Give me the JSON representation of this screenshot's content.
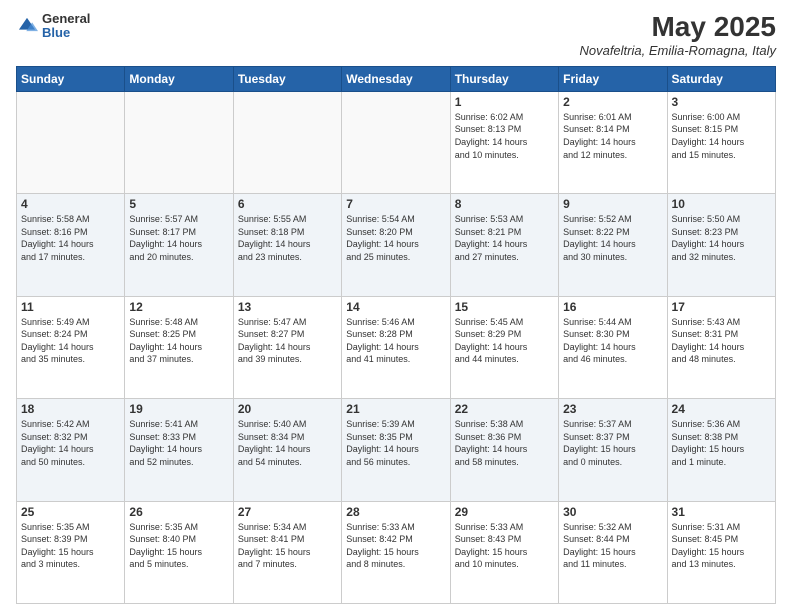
{
  "header": {
    "logo_general": "General",
    "logo_blue": "Blue",
    "title": "May 2025",
    "location": "Novafeltria, Emilia-Romagna, Italy"
  },
  "days_of_week": [
    "Sunday",
    "Monday",
    "Tuesday",
    "Wednesday",
    "Thursday",
    "Friday",
    "Saturday"
  ],
  "weeks": [
    [
      {
        "day": "",
        "info": ""
      },
      {
        "day": "",
        "info": ""
      },
      {
        "day": "",
        "info": ""
      },
      {
        "day": "",
        "info": ""
      },
      {
        "day": "1",
        "info": "Sunrise: 6:02 AM\nSunset: 8:13 PM\nDaylight: 14 hours\nand 10 minutes."
      },
      {
        "day": "2",
        "info": "Sunrise: 6:01 AM\nSunset: 8:14 PM\nDaylight: 14 hours\nand 12 minutes."
      },
      {
        "day": "3",
        "info": "Sunrise: 6:00 AM\nSunset: 8:15 PM\nDaylight: 14 hours\nand 15 minutes."
      }
    ],
    [
      {
        "day": "4",
        "info": "Sunrise: 5:58 AM\nSunset: 8:16 PM\nDaylight: 14 hours\nand 17 minutes."
      },
      {
        "day": "5",
        "info": "Sunrise: 5:57 AM\nSunset: 8:17 PM\nDaylight: 14 hours\nand 20 minutes."
      },
      {
        "day": "6",
        "info": "Sunrise: 5:55 AM\nSunset: 8:18 PM\nDaylight: 14 hours\nand 23 minutes."
      },
      {
        "day": "7",
        "info": "Sunrise: 5:54 AM\nSunset: 8:20 PM\nDaylight: 14 hours\nand 25 minutes."
      },
      {
        "day": "8",
        "info": "Sunrise: 5:53 AM\nSunset: 8:21 PM\nDaylight: 14 hours\nand 27 minutes."
      },
      {
        "day": "9",
        "info": "Sunrise: 5:52 AM\nSunset: 8:22 PM\nDaylight: 14 hours\nand 30 minutes."
      },
      {
        "day": "10",
        "info": "Sunrise: 5:50 AM\nSunset: 8:23 PM\nDaylight: 14 hours\nand 32 minutes."
      }
    ],
    [
      {
        "day": "11",
        "info": "Sunrise: 5:49 AM\nSunset: 8:24 PM\nDaylight: 14 hours\nand 35 minutes."
      },
      {
        "day": "12",
        "info": "Sunrise: 5:48 AM\nSunset: 8:25 PM\nDaylight: 14 hours\nand 37 minutes."
      },
      {
        "day": "13",
        "info": "Sunrise: 5:47 AM\nSunset: 8:27 PM\nDaylight: 14 hours\nand 39 minutes."
      },
      {
        "day": "14",
        "info": "Sunrise: 5:46 AM\nSunset: 8:28 PM\nDaylight: 14 hours\nand 41 minutes."
      },
      {
        "day": "15",
        "info": "Sunrise: 5:45 AM\nSunset: 8:29 PM\nDaylight: 14 hours\nand 44 minutes."
      },
      {
        "day": "16",
        "info": "Sunrise: 5:44 AM\nSunset: 8:30 PM\nDaylight: 14 hours\nand 46 minutes."
      },
      {
        "day": "17",
        "info": "Sunrise: 5:43 AM\nSunset: 8:31 PM\nDaylight: 14 hours\nand 48 minutes."
      }
    ],
    [
      {
        "day": "18",
        "info": "Sunrise: 5:42 AM\nSunset: 8:32 PM\nDaylight: 14 hours\nand 50 minutes."
      },
      {
        "day": "19",
        "info": "Sunrise: 5:41 AM\nSunset: 8:33 PM\nDaylight: 14 hours\nand 52 minutes."
      },
      {
        "day": "20",
        "info": "Sunrise: 5:40 AM\nSunset: 8:34 PM\nDaylight: 14 hours\nand 54 minutes."
      },
      {
        "day": "21",
        "info": "Sunrise: 5:39 AM\nSunset: 8:35 PM\nDaylight: 14 hours\nand 56 minutes."
      },
      {
        "day": "22",
        "info": "Sunrise: 5:38 AM\nSunset: 8:36 PM\nDaylight: 14 hours\nand 58 minutes."
      },
      {
        "day": "23",
        "info": "Sunrise: 5:37 AM\nSunset: 8:37 PM\nDaylight: 15 hours\nand 0 minutes."
      },
      {
        "day": "24",
        "info": "Sunrise: 5:36 AM\nSunset: 8:38 PM\nDaylight: 15 hours\nand 1 minute."
      }
    ],
    [
      {
        "day": "25",
        "info": "Sunrise: 5:35 AM\nSunset: 8:39 PM\nDaylight: 15 hours\nand 3 minutes."
      },
      {
        "day": "26",
        "info": "Sunrise: 5:35 AM\nSunset: 8:40 PM\nDaylight: 15 hours\nand 5 minutes."
      },
      {
        "day": "27",
        "info": "Sunrise: 5:34 AM\nSunset: 8:41 PM\nDaylight: 15 hours\nand 7 minutes."
      },
      {
        "day": "28",
        "info": "Sunrise: 5:33 AM\nSunset: 8:42 PM\nDaylight: 15 hours\nand 8 minutes."
      },
      {
        "day": "29",
        "info": "Sunrise: 5:33 AM\nSunset: 8:43 PM\nDaylight: 15 hours\nand 10 minutes."
      },
      {
        "day": "30",
        "info": "Sunrise: 5:32 AM\nSunset: 8:44 PM\nDaylight: 15 hours\nand 11 minutes."
      },
      {
        "day": "31",
        "info": "Sunrise: 5:31 AM\nSunset: 8:45 PM\nDaylight: 15 hours\nand 13 minutes."
      }
    ]
  ]
}
